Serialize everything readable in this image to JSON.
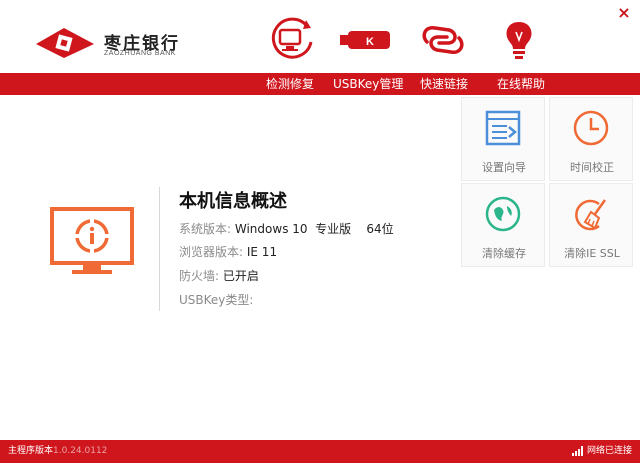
{
  "header": {
    "logo_cn": "枣庄银行",
    "logo_en": "ZAOZHUANG BANK",
    "close_glyph": "×",
    "top_icons": [
      "monitor-repair-icon",
      "usbkey-icon",
      "link-icon",
      "bulb-icon"
    ]
  },
  "menu": {
    "items": [
      {
        "label": "检测修复"
      },
      {
        "label": "USBKey管理"
      },
      {
        "label": "快速链接"
      },
      {
        "label": "在线帮助"
      }
    ]
  },
  "info": {
    "title": "本机信息概述",
    "system_label": "系统版本:",
    "system_value": "Windows 10  专业版    64位",
    "browser_label": "浏览器版本:",
    "browser_value": "IE 11",
    "firewall_label": "防火墙:",
    "firewall_value": "已开启",
    "usbkey_label": "USBKey类型:",
    "usbkey_value": ""
  },
  "tiles": [
    {
      "label": "设置向导",
      "icon": "setup-wizard-icon"
    },
    {
      "label": "时间校正",
      "icon": "clock-icon"
    },
    {
      "label": "清除缓存",
      "icon": "clear-cache-icon"
    },
    {
      "label": "清除IE SSL",
      "icon": "broom-icon"
    }
  ],
  "status": {
    "version_label": "主程序版本",
    "version_value": "1.0.24.0112",
    "network": "网络已连接"
  },
  "colors": {
    "brand_red": "#d0161d",
    "icon_orange": "#f06a35",
    "icon_blue": "#4a8fd8",
    "icon_green": "#2bb58a"
  }
}
